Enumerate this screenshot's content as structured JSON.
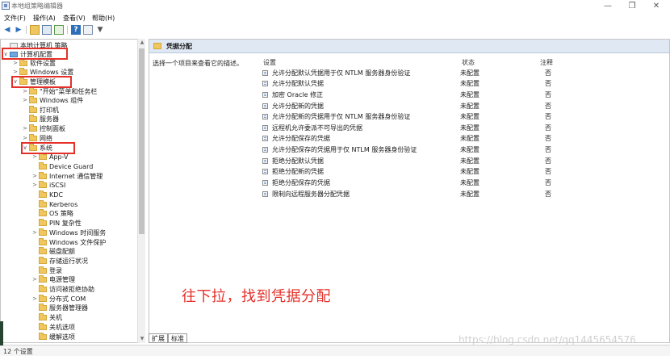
{
  "window": {
    "title": "本地组策略编辑器",
    "controls": [
      "—",
      "❐",
      "✕"
    ]
  },
  "menu": [
    "文件(F)",
    "操作(A)",
    "查看(V)",
    "帮助(H)"
  ],
  "toolbar": {
    "icons": [
      "back-arrow-icon",
      "forward-arrow-icon",
      "up-folder-icon",
      "show-hide-tree-icon",
      "export-list-icon",
      "help-icon",
      "properties-icon",
      "filter-icon"
    ]
  },
  "tree": {
    "items": [
      {
        "label": "本地计算机 策略",
        "level": 0,
        "expander": "",
        "icon": "policy"
      },
      {
        "label": "计算机配置",
        "level": 0,
        "expander": "∨",
        "icon": "pc"
      },
      {
        "label": "软件设置",
        "level": 1,
        "expander": ">",
        "icon": "folder"
      },
      {
        "label": "Windows 设置",
        "level": 1,
        "expander": ">",
        "icon": "folder"
      },
      {
        "label": "管理模板",
        "level": 1,
        "expander": "∨",
        "icon": "folder"
      },
      {
        "label": "\"开始\"菜单和任务栏",
        "level": 2,
        "expander": ">",
        "icon": "folder"
      },
      {
        "label": "Windows 组件",
        "level": 2,
        "expander": ">",
        "icon": "folder"
      },
      {
        "label": "打印机",
        "level": 2,
        "expander": "",
        "icon": "folder"
      },
      {
        "label": "服务器",
        "level": 2,
        "expander": "",
        "icon": "folder"
      },
      {
        "label": "控制面板",
        "level": 2,
        "expander": ">",
        "icon": "folder"
      },
      {
        "label": "网络",
        "level": 2,
        "expander": ">",
        "icon": "folder"
      },
      {
        "label": "系统",
        "level": 2,
        "expander": "∨",
        "icon": "folder"
      },
      {
        "label": "App-V",
        "level": 3,
        "expander": ">",
        "icon": "folder"
      },
      {
        "label": "Device Guard",
        "level": 3,
        "expander": "",
        "icon": "folder"
      },
      {
        "label": "Internet 通信管理",
        "level": 3,
        "expander": ">",
        "icon": "folder"
      },
      {
        "label": "iSCSI",
        "level": 3,
        "expander": ">",
        "icon": "folder"
      },
      {
        "label": "KDC",
        "level": 3,
        "expander": "",
        "icon": "folder"
      },
      {
        "label": "Kerberos",
        "level": 3,
        "expander": "",
        "icon": "folder"
      },
      {
        "label": "OS 策略",
        "level": 3,
        "expander": "",
        "icon": "folder"
      },
      {
        "label": "PIN 复杂性",
        "level": 3,
        "expander": "",
        "icon": "folder"
      },
      {
        "label": "Windows 时间服务",
        "level": 3,
        "expander": ">",
        "icon": "folder"
      },
      {
        "label": "Windows 文件保护",
        "level": 3,
        "expander": "",
        "icon": "folder"
      },
      {
        "label": "磁盘配额",
        "level": 3,
        "expander": "",
        "icon": "folder"
      },
      {
        "label": "存储运行状况",
        "level": 3,
        "expander": "",
        "icon": "folder"
      },
      {
        "label": "登录",
        "level": 3,
        "expander": "",
        "icon": "folder"
      },
      {
        "label": "电源管理",
        "level": 3,
        "expander": ">",
        "icon": "folder"
      },
      {
        "label": "访问被拒绝协助",
        "level": 3,
        "expander": "",
        "icon": "folder"
      },
      {
        "label": "分布式 COM",
        "level": 3,
        "expander": ">",
        "icon": "folder"
      },
      {
        "label": "服务器管理器",
        "level": 3,
        "expander": "",
        "icon": "folder"
      },
      {
        "label": "关机",
        "level": 3,
        "expander": "",
        "icon": "folder"
      },
      {
        "label": "关机选项",
        "level": 3,
        "expander": "",
        "icon": "folder"
      },
      {
        "label": "缓解选项",
        "level": 3,
        "expander": "",
        "icon": "folder"
      }
    ]
  },
  "right": {
    "header": "凭据分配",
    "description": "选择一个项目来查看它的描述。",
    "columns": {
      "setting": "设置",
      "state": "状态",
      "comment": "注释"
    },
    "rows": [
      {
        "setting": "允许分配默认凭据用于仅 NTLM 服务器身份验证",
        "state": "未配置",
        "comment": "否"
      },
      {
        "setting": "允许分配默认凭据",
        "state": "未配置",
        "comment": "否"
      },
      {
        "setting": "加密 Oracle 修正",
        "state": "未配置",
        "comment": "否"
      },
      {
        "setting": "允许分配新的凭据",
        "state": "未配置",
        "comment": "否"
      },
      {
        "setting": "允许分配新的凭据用于仅 NTLM 服务器身份验证",
        "state": "未配置",
        "comment": "否"
      },
      {
        "setting": "远程机允许委派不可导出的凭据",
        "state": "未配置",
        "comment": "否"
      },
      {
        "setting": "允许分配保存的凭据",
        "state": "未配置",
        "comment": "否"
      },
      {
        "setting": "允许分配保存的凭据用于仅 NTLM 服务器身份验证",
        "state": "未配置",
        "comment": "否"
      },
      {
        "setting": "拒绝分配默认凭据",
        "state": "未配置",
        "comment": "否"
      },
      {
        "setting": "拒绝分配新的凭据",
        "state": "未配置",
        "comment": "否"
      },
      {
        "setting": "拒绝分配保存的凭据",
        "state": "未配置",
        "comment": "否"
      },
      {
        "setting": "限制向远程服务器分配凭据",
        "state": "未配置",
        "comment": "否"
      }
    ]
  },
  "annotation": "往下拉，找到凭据分配",
  "tabs": [
    "扩展",
    "标准"
  ],
  "status": "12 个设置",
  "watermark": "https://blog.csdn.net/qq1445654576"
}
